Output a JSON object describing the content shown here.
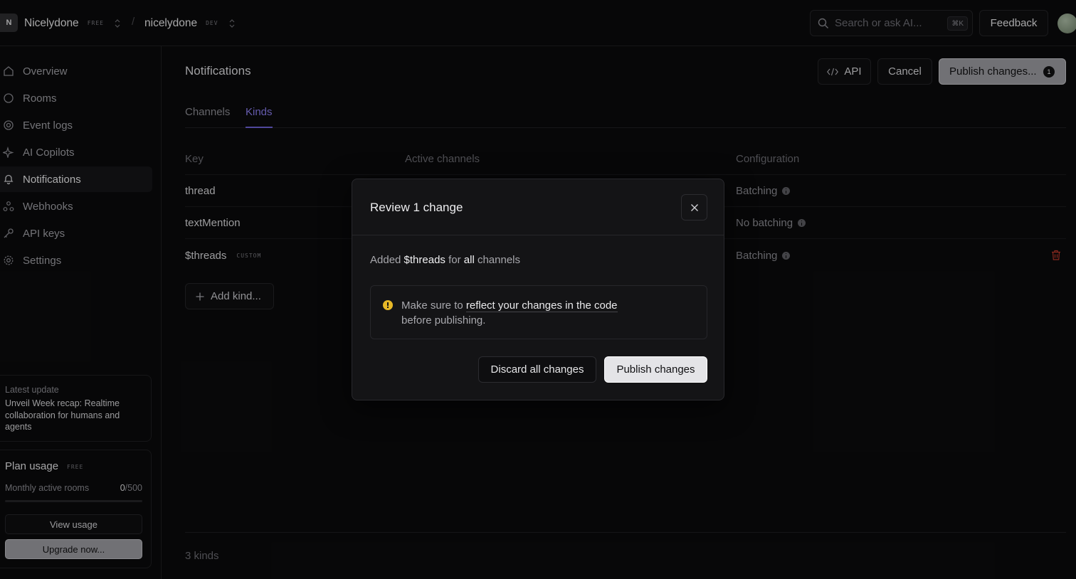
{
  "topbar": {
    "org_initial": "N",
    "org_name": "Nicelydone",
    "org_plan": "FREE",
    "separator": "/",
    "project_name": "nicelydone",
    "project_env": "DEV",
    "search_placeholder": "Search or ask AI...",
    "search_shortcut": "⌘K",
    "feedback_label": "Feedback"
  },
  "sidebar": {
    "items": [
      {
        "label": "Overview",
        "icon": "home-icon"
      },
      {
        "label": "Rooms",
        "icon": "circle-icon"
      },
      {
        "label": "Event logs",
        "icon": "target-icon"
      },
      {
        "label": "AI Copilots",
        "icon": "sparkle-icon"
      },
      {
        "label": "Notifications",
        "icon": "bell-icon",
        "active": true
      },
      {
        "label": "Webhooks",
        "icon": "webhook-icon"
      },
      {
        "label": "API keys",
        "icon": "key-icon"
      },
      {
        "label": "Settings",
        "icon": "gear-icon"
      }
    ],
    "latest": {
      "caption": "Latest update",
      "text": "Unveil Week recap: Realtime collaboration for humans and agents"
    },
    "plan": {
      "title": "Plan usage",
      "badge": "FREE",
      "metric_label": "Monthly active rooms",
      "metric_current": "0",
      "metric_total": "/500",
      "progress": 0,
      "view_usage": "View usage",
      "upgrade": "Upgrade now..."
    }
  },
  "main": {
    "title": "Notifications",
    "api_label": "API",
    "cancel_label": "Cancel",
    "publish_label": "Publish changes...",
    "pending_count": "1",
    "tabs": [
      {
        "label": "Channels",
        "active": false
      },
      {
        "label": "Kinds",
        "active": true
      }
    ],
    "table": {
      "headers": [
        "Key",
        "Active channels",
        "Configuration"
      ],
      "rows": [
        {
          "key": "thread",
          "badge": "",
          "configuration": "Batching"
        },
        {
          "key": "textMention",
          "badge": "",
          "configuration": "No batching"
        },
        {
          "key": "$threads",
          "badge": "CUSTOM",
          "configuration": "Batching"
        }
      ]
    },
    "add_kind": "Add kind...",
    "footer_count": "3 kinds"
  },
  "modal": {
    "title": "Review 1 change",
    "change_prefix": "Added ",
    "change_kind": "$threads",
    "change_mid": " for ",
    "change_scope": "all",
    "change_suffix": " channels",
    "warning_prefix": "Make sure to ",
    "warning_link": "reflect your changes in the code",
    "warning_suffix": " before publishing.",
    "discard_label": "Discard all changes",
    "publish_label": "Publish changes"
  },
  "colors": {
    "accent": "#8c7ff0",
    "warning": "#e7b827",
    "danger": "#c0392b"
  }
}
